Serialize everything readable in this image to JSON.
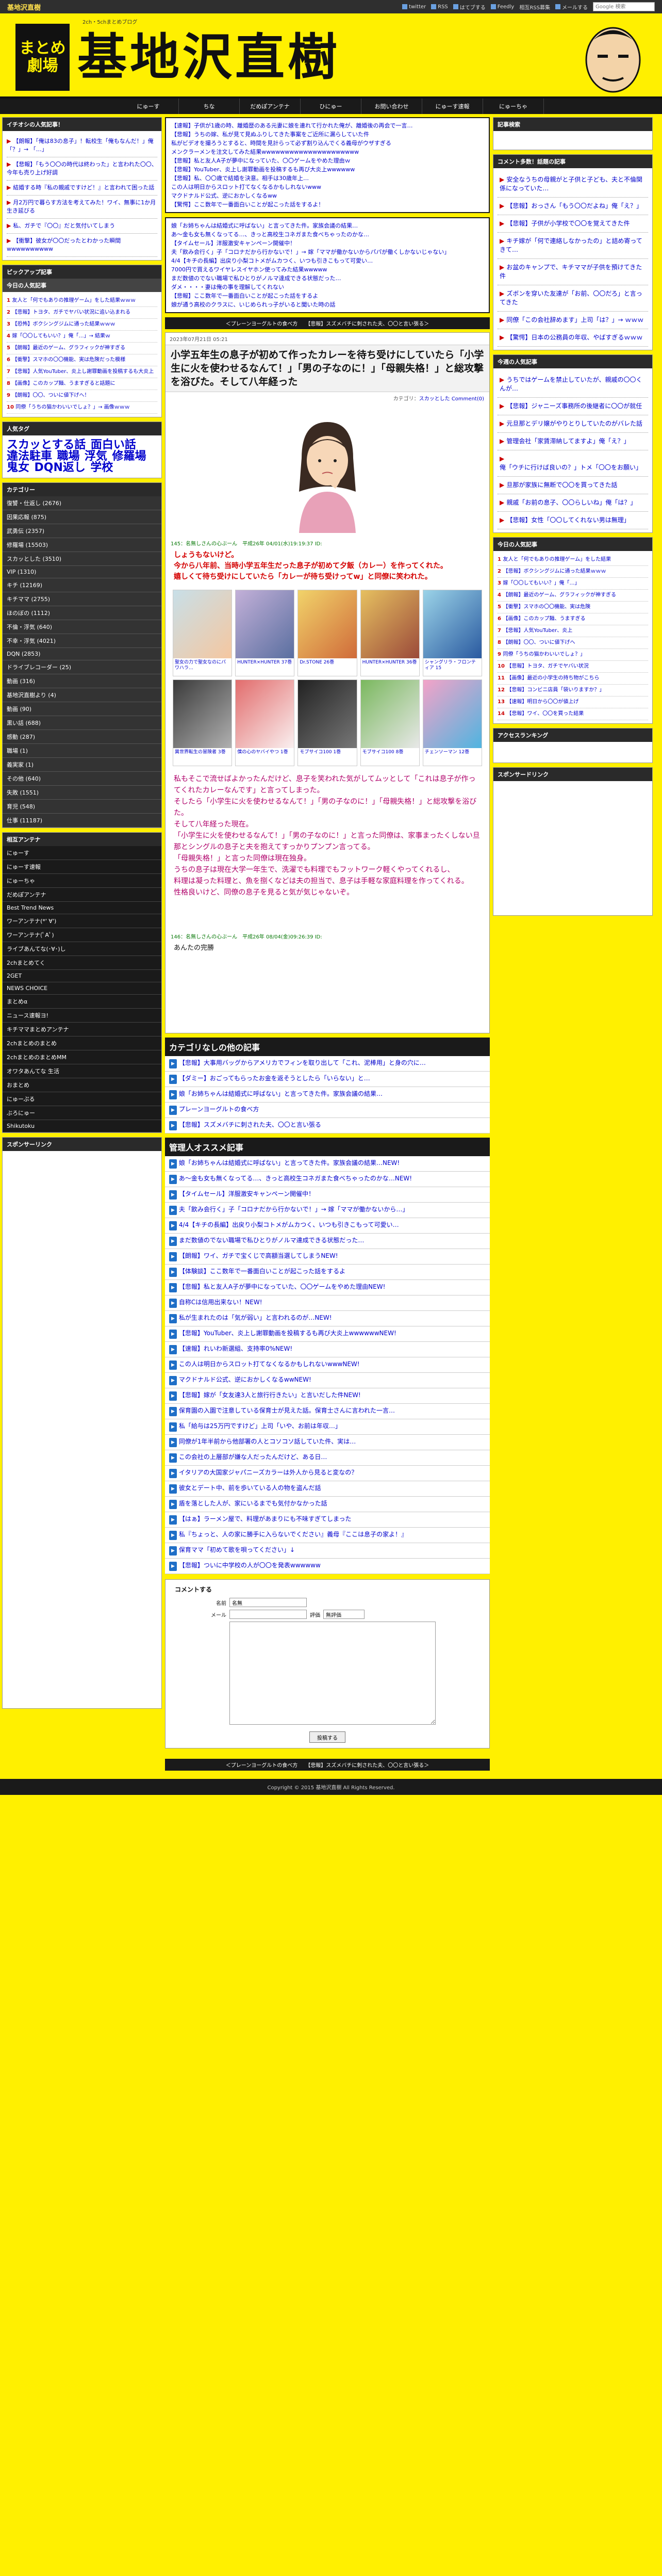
{
  "topbar": {
    "site": "基地沢直樹",
    "links": [
      "twitter",
      "RSS",
      "はてブする",
      "Feedly",
      "相互RSS募集",
      "メールする",
      "Google 検索"
    ],
    "search_placeholder": "Google 検索"
  },
  "banner": {
    "logo_small": [
      "まとめ",
      "劇場"
    ],
    "logo_main": "基地沢直樹",
    "tagline": "2ch・5chまとめブログ"
  },
  "nav": [
    "にゅーす",
    "ちな",
    "だめぽアンテナ",
    "ひにゅー",
    "お問い合わせ",
    "にゅーす速報",
    "にゅーちゃ"
  ],
  "left": {
    "news_head": "イチオシの人気記事！",
    "news": [
      "【朗報】「俺は83の息子」！転校生「俺もなんだ！」俺「？」→ 「…」",
      "【悲報】「もう〇〇の時代は終わった」と言われた〇〇、今年も売り上げ好調",
      "結婚する時『私の親戚ですけど！』と言われて困った話",
      "月2万円で暮らす方法を考えてみた！ワイ、無事に1か月生き延びる",
      "私、ガチで『〇〇』だと気付いてしまう",
      "【衝撃】彼女が〇〇だったとわかった瞬間wwwwwwwwww"
    ],
    "pickup_head": "ピックアップ記事",
    "rank_head": "今日の人気記事",
    "rank": [
      "友人と「何でもありの推理ゲーム」をした結果ｗｗｗ",
      "【悲報】トヨタ、ガチでヤバい状況に追い込まれる",
      "【恐怖】ボクシングジムに通った結果ｗｗｗ",
      "嫁「〇〇してもいい？」俺「…」→ 結果ｗ",
      "【朗報】最近のゲーム、グラフィックが神すぎる",
      "【衝撃】スマホの〇〇機能、実は危険だった模様",
      "【悲報】人気YouTuber、炎上し謝罪動画を投稿するも大炎上",
      "【画像】このカップ麺、うますぎると話題に",
      "【朗報】〇〇、ついに値下げへ！",
      "同僚「うちの猫かわいいでしょ？」→ 画像ｗｗｗ"
    ],
    "tag_head": "人気タグ",
    "tags": [
      "スカッとする話",
      "面白い話",
      "違法駐車",
      "職場",
      "浮気",
      "修羅場",
      "鬼女",
      "DQN返し",
      "学校"
    ],
    "cat_head": "カテゴリー",
    "cats": [
      "復讐・仕返し (2676)",
      "因果応報 (875)",
      "武勇伝 (2357)",
      "修羅場 (15503)",
      "スカッとした (3510)",
      "VIP (1310)",
      "キチ (12169)",
      "キチママ (2755)",
      "ほのぼの (1112)",
      "不倫・浮気 (640)",
      "不幸・浮気 (4021)",
      "DQN (2853)",
      "ドライブレコーダー (25)",
      "動画 (316)",
      "基地沢直樹より (4)",
      "動画 (90)",
      "黒い話 (688)",
      "感動 (287)",
      "職場 (1)",
      "義実家 (1)",
      "その他 (640)",
      "失敗 (1551)",
      "育児 (548)",
      "仕事 (11187)"
    ],
    "ant_head": "相互アンテナ",
    "ants": [
      "にゅーす",
      "にゅーす速報",
      "にゅーちゃ",
      "だめぽアンテナ",
      "Best Trend News",
      "ワーアンテナ(*' ∀')",
      "ワーアンテナ(ﾟAﾟ)",
      "ライブあんてな(･∀･)し",
      "2chまとめてく",
      "2GET",
      "NEWS CHOICE",
      "まとめα",
      "ニュース速報ヨ!",
      "キチママまとめアンテナ",
      "2chまとめのまとめ",
      "2chまとめのまとめMM",
      "オワタあんてな 生活",
      "おまとめ",
      "にゅーぷる",
      "ぶろにゅー",
      "Shikutoku"
    ],
    "sponsor_head": "スポンサーリンク"
  },
  "center": {
    "toplinks": [
      "【速報】子供が1歳の時、離婚歴のある元妻に娘を連れて行かれた俺が、離婚後の再会で一言…",
      "【悲報】うちの嫁、私が見て見ぬふりしてきた事案をご近所に漏らしていた件",
      "私がビデオを撮ろうとすると、時間を見計らって必ず割り込んでくる義母がウザすぎる",
      "メンクラーメンを注文してみた結果wwwwwwwwwwwwwwwwwwwww",
      "【悲報】私と友人A子が夢中になっていた、〇〇ゲームをやめた理由ｗ",
      "【悲報】YouTuber、炎上し謝罪動画を投稿するも再び大炎上wwwwww",
      "【悲報】私、〇〇歳で結婚を決意。相手は30歳年上…",
      "この人は明日からスロット打てなくなるかもしれないwww",
      "マクドナルド公式、逆におかしくなるww",
      "【驚愕】ここ数年で一番面白いことが起こった話をするよ！"
    ],
    "toplinks2": [
      "娘「お姉ちゃんは結婚式に呼ばない」と言ってきた件。家族会議の結果…",
      "あ～金も女も無くなってる…、きっと高校生コネガまた食べちゃったのかな…",
      "【タイムセール】洋服激安キャンペーン開催中！",
      "夫「飲み会行く」子「コロナだから行かないで！」→ 嫁「ママが働かないからパパが働くしかないじゃない」",
      "4/4【キチの長編】出戻り小梨コトメがムカつく、いつも引きこもって可愛い…",
      "7000円で買えるワイヤレスイヤホン使ってみた結果wwwww",
      "まだ数値のでない職場で私ひとりがノルマ達成できる状態だった…",
      "ダメ・・・・妻は俺の事を理解してくれない",
      "【悲報】ここ数年で一番面白いことが起こった話をするよ",
      "娘が通う高校のクラスに、いじめられっ子がいると聞いた時の話"
    ],
    "pager": "＜プレーンヨーグルトの食べ方　　【悲報】スズメバチに刺された夫、〇〇と言い張る＞",
    "article": {
      "date": "2023年07月21日 05:21",
      "title": "小学五年生の息子が初めて作ったカレーを待ち受けにしていたら「小学生に火を使わせるなんて！」「男の子なのに！」「母親失格！」と総攻撃を浴びた。そして八年経った",
      "category_label": "カテゴリ：",
      "category": "スカッとした",
      "comments": "Comment(0)",
      "res1_head": "145：名無しさんの心ぶーん　平成26年 04/01(水)19:19:37 ID:",
      "res1_text": "しょうもないけど。\n今から八年前、当時小学五年生だった息子が初めて夕飯（カレー）を作ってくれた。\n嬉しくて待ち受けにしていたら「カレーが待ち受けってw」と同僚に笑われた。",
      "res2_text": "私もそこで流せばよかったんだけど、息子を笑われた気がしてムッとして「これは息子が作ってくれたカレーなんです」と言ってしまった。\nそしたら「小学生に火を使わせるなんて！」「男の子なのに！」「母親失格！」と総攻撃を浴びた。\nそして八年経った現在。\n「小学生に火を使わせるなんて！」「男の子なのに！」と言った同僚は、家事まったくしない旦那とシングルの息子と夫を抱えてすっかりプンプン言ってる。\n「母親失格！」と言った同僚は現在独身。\nうちの息子は現在大学一年生で、洗濯でも料理でもフットワーク軽くやってくれるし、\n料理は凝った料理と、魚を捌くなどは夫の担当で、息子は手軽な家庭料理を作ってくれる。\n性格良いけど、同僚の息子を見ると気が気じゃないぞ。",
      "res3_head": "146：名無しさんの心ぶーん　平成26年 08/04(金)09:26:39 ID:",
      "res3_text": "あんたの完勝",
      "grid": [
        "聖女の力で聖女なのにパワハラ…",
        "HUNTER×HUNTER 37巻",
        "Dr.STONE 26巻",
        "HUNTER×HUNTER 36巻",
        "シャングリラ・フロンティア 15",
        "異世界転生の冒険者 3巻",
        "僕の心のヤバイやつ 1巻",
        "モブサイコ100 1巻",
        "モブサイコ100 8巻",
        "チェンソーマン 12巻"
      ]
    },
    "nocat_head": "カテゴリなしの他の記事",
    "nocat": [
      "【悲報】大事用バッグからアメリカでフィンを取り出して「これ、泥棒用」と身の穴に…",
      "【ダミー】おごってもらったお金を返そうとしたら「いらない」と…",
      "娘「お姉ちゃんは結婚式に呼ばない」と言ってきた件。家族会議の結果…",
      "プレーンヨーグルトの食べ方",
      "【悲報】スズメバチに刺された夫、〇〇と言い張る"
    ],
    "osusume_head": "管理人オススメ記事",
    "osusume": [
      "娘「お姉ちゃんは結婚式に呼ばない」と言ってきた件。家族会議の結果…NEW!",
      "あ～金も女も無くなってる…、きっと高校生コネガまた食べちゃったのかな…NEW!",
      "【タイムセール】洋服激安キャンペーン開催中！",
      "夫「飲み会行く」子「コロナだから行かないで！」→ 嫁「ママが働かないから…」",
      "4/4【キチの長編】出戻り小梨コトメがムカつく、いつも引きこもって可愛い…",
      "まだ数値のでない職場で私ひとりがノルマ達成できる状態だった…",
      "【朗報】ワイ、ガチで宝くじで高額当選してしまうNEW!",
      "【体験談】ここ数年で一番面白いことが起こった話をするよ",
      "【悲報】私と友人A子が夢中になっていた、〇〇ゲームをやめた理由NEW!",
      "自称Cは信用出来ない！NEW!",
      "私が生まれたのは「気が弱い」と言われるのが…NEW!",
      "【悲報】YouTuber、炎上し謝罪動画を投稿するも再び大炎上wwwwwwNEW!",
      "【速報】れいわ新選組、支持率0%NEW!",
      "この人は明日からスロット打てなくなるかもしれないwwwNEW!",
      "マクドナルド公式、逆におかしくなるwwNEW!",
      "【悲報】嫁が「女友達3人と旅行行きたい」と言いだした件NEW!",
      "保育園の入園で注意している保育士が見えた話。保育士さんに言われた一言…",
      "私「給与は25万円ですけど」上司「いや、お前は年収…」",
      "同僚が1年半前から他部署の人とコソコソ話していた件、実は…",
      "この会社の上層部が嫌な人だったんだけど、ある日…",
      "イタリアの大国家ジャパニーズカラーは外人から見ると変なの？",
      "彼女とデート中、前を歩いている人の物を盗んだ話",
      "盾を落とした人が、家にいるまでも気付かなかった話",
      "【はぁ】ラーメン屋で、料理があまりにも不味すぎてしまった",
      "私『ちょっと、人の家に勝手に入らないでください』義母『ここは息子の家よ！』",
      "保育ママ「初めて歌を唄ってください」↓",
      "【悲報】ついに中学校の人が〇〇を発表wwwwww"
    ],
    "comment_head": "コメントする",
    "form": {
      "name_label": "名前",
      "name_value": "名無",
      "mail_label": "メール",
      "rate_label": "評価",
      "rate_value": "無評価",
      "submit": "投稿する"
    }
  },
  "right": {
    "rec_head": "記事検索",
    "rec_head2": "コメント多数！話題の記事",
    "rec": [
      "安全なうちの母親がと子供と子ども、夫と不倫関係になっていた…",
      "【悲報】おっさん「もう〇〇だよね」俺「え？」",
      "【悲報】子供が小学校で〇〇を覚えてきた件",
      "キチ嫁が「何で連絡しなかったの」と詰め寄ってきて…",
      "お盆のキャンプで、キチママが子供を預けてきた件",
      "ズボンを穿いた友達が「お前、〇〇だろ」と言ってきた",
      "同僚「この会社辞めます」上司「は？」→ ｗｗｗ",
      "【驚愕】日本の公務員の年収、やばすぎるｗｗｗ"
    ],
    "pop_head": "今週の人気記事",
    "pop": [
      "うちではゲームを禁止していたが、親戚の〇〇くんが…",
      "【悲報】ジャニーズ事務所の後継者に〇〇が就任",
      "元旦那とデリ嬢がやりとりしていたのがバレた話",
      "管理会社「家賃滞納してますよ」俺「え？」",
      "俺「ウチに行けば良いの？」トメ「〇〇をお願い」",
      "旦那が家族に無断で〇〇を買ってきた話",
      "親戚「お前の息子、〇〇らしいね」俺「は？」",
      "【悲報】女性「〇〇してくれない男は無理」"
    ],
    "rank_head": "今日の人気記事",
    "rank": [
      "友人と「何でもありの推理ゲーム」をした結果",
      "【悲報】ボクシングジムに通った結果ｗｗｗ",
      "嫁「〇〇してもいい？」俺「…」",
      "【朗報】最近のゲーム、グラフィックが神すぎる",
      "【衝撃】スマホの〇〇機能、実は危険",
      "【画像】このカップ麺、うますぎる",
      "【悲報】人気YouTuber、炎上",
      "【朗報】〇〇、ついに値下げへ",
      "同僚「うちの猫かわいいでしょ？」",
      "【悲報】トヨタ、ガチでヤバい状況",
      "【画像】最近の小学生の持ち物がこちら",
      "【悲報】コンビニ店員「袋いりますか？」",
      "【速報】明日から〇〇が値上げ",
      "【悲報】ワイ、〇〇を買った結果"
    ],
    "access_head": "アクセスランキング",
    "sponsor_head": "スポンサードリンク"
  },
  "footer": "Copyright © 2015 基地沢直樹 All Rights Reserved."
}
